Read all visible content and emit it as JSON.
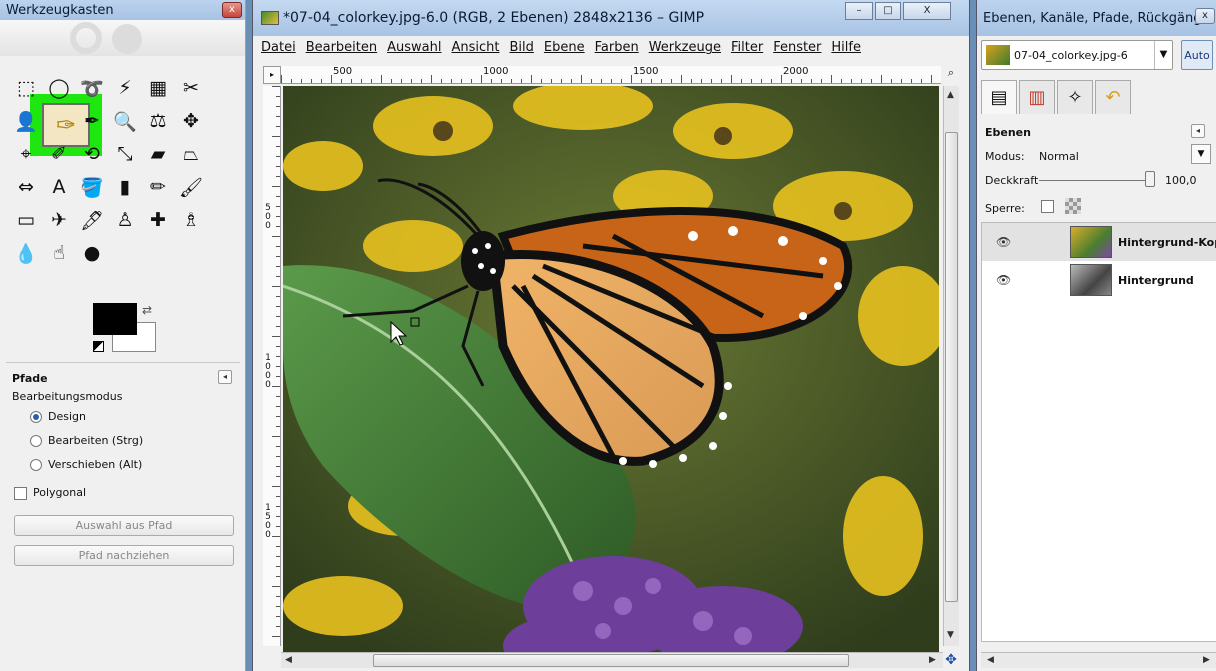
{
  "toolbox": {
    "title": "Werkzeugkasten",
    "close_label": "x",
    "tools": [
      {
        "name": "rect-select-icon",
        "glyph": "⬚"
      },
      {
        "name": "ellipse-select-icon",
        "glyph": "◯"
      },
      {
        "name": "free-select-icon",
        "glyph": "➰"
      },
      {
        "name": "fuzzy-select-icon",
        "glyph": "⚡"
      },
      {
        "name": "color-select-icon",
        "glyph": "▦"
      },
      {
        "name": "scissors-select-icon",
        "glyph": "✂"
      },
      {
        "name": "foreground-select-icon",
        "glyph": "👤"
      },
      {
        "name": "paths-tool-icon",
        "glyph": ""
      },
      {
        "name": "color-picker-icon",
        "glyph": "✒"
      },
      {
        "name": "zoom-tool-icon",
        "glyph": "🔍"
      },
      {
        "name": "measure-tool-icon",
        "glyph": "⚖"
      },
      {
        "name": "move-tool-icon",
        "glyph": "✥"
      },
      {
        "name": "align-tool-icon",
        "glyph": "⌖"
      },
      {
        "name": "crop-tool-icon",
        "glyph": "✐"
      },
      {
        "name": "rotate-tool-icon",
        "glyph": "⟲"
      },
      {
        "name": "scale-tool-icon",
        "glyph": "⤡"
      },
      {
        "name": "shear-tool-icon",
        "glyph": "▰"
      },
      {
        "name": "perspective-tool-icon",
        "glyph": "⏢"
      },
      {
        "name": "flip-tool-icon",
        "glyph": "⇔"
      },
      {
        "name": "text-tool-icon",
        "glyph": "A"
      },
      {
        "name": "bucket-fill-icon",
        "glyph": "🪣"
      },
      {
        "name": "blend-tool-icon",
        "glyph": "▮"
      },
      {
        "name": "pencil-tool-icon",
        "glyph": "✏"
      },
      {
        "name": "paintbrush-tool-icon",
        "glyph": "🖌"
      },
      {
        "name": "eraser-tool-icon",
        "glyph": "▭"
      },
      {
        "name": "airbrush-tool-icon",
        "glyph": "✈"
      },
      {
        "name": "ink-tool-icon",
        "glyph": "🖋"
      },
      {
        "name": "clone-tool-icon",
        "glyph": "♙"
      },
      {
        "name": "heal-tool-icon",
        "glyph": "✚"
      },
      {
        "name": "perspective-clone-icon",
        "glyph": "♗"
      },
      {
        "name": "blur-tool-icon",
        "glyph": "💧"
      },
      {
        "name": "smudge-tool-icon",
        "glyph": "☝"
      },
      {
        "name": "dodge-burn-icon",
        "glyph": "●"
      }
    ],
    "options": {
      "title": "Pfade",
      "mode_label": "Bearbeitungsmodus",
      "modes": [
        "Design",
        "Bearbeiten (Strg)",
        "Verschieben (Alt)"
      ],
      "polygonal_label": "Polygonal",
      "selection_button": "Auswahl aus Pfad",
      "stroke_button": "Pfad nachziehen"
    }
  },
  "image_window": {
    "title": "*07-04_colorkey.jpg-6.0 (RGB, 2 Ebenen) 2848x2136 – GIMP",
    "menu": [
      "Datei",
      "Bearbeiten",
      "Auswahl",
      "Ansicht",
      "Bild",
      "Ebene",
      "Farben",
      "Werkzeuge",
      "Filter",
      "Fenster",
      "Hilfe"
    ],
    "ruler_top_labels": [
      "500",
      "1000",
      "1500",
      "2000"
    ],
    "ruler_left_labels": [
      "500",
      "1000",
      "1500"
    ],
    "window_buttons": {
      "minimize": "–",
      "maximize": "□",
      "close": "X"
    }
  },
  "layers_window": {
    "title": "Ebenen, Kanäle, Pfade, Rückgäng...",
    "image_selector": "07-04_colorkey.jpg-6",
    "auto_label": "Auto",
    "section_title": "Ebenen",
    "mode_label": "Modus:",
    "mode_value": "Normal",
    "opacity_label": "Deckkraft",
    "opacity_value": "100,0",
    "lock_label": "Sperre:",
    "layers": [
      {
        "name": "Hintergrund-Kopi",
        "selected": true
      },
      {
        "name": "Hintergrund",
        "selected": false
      }
    ]
  }
}
